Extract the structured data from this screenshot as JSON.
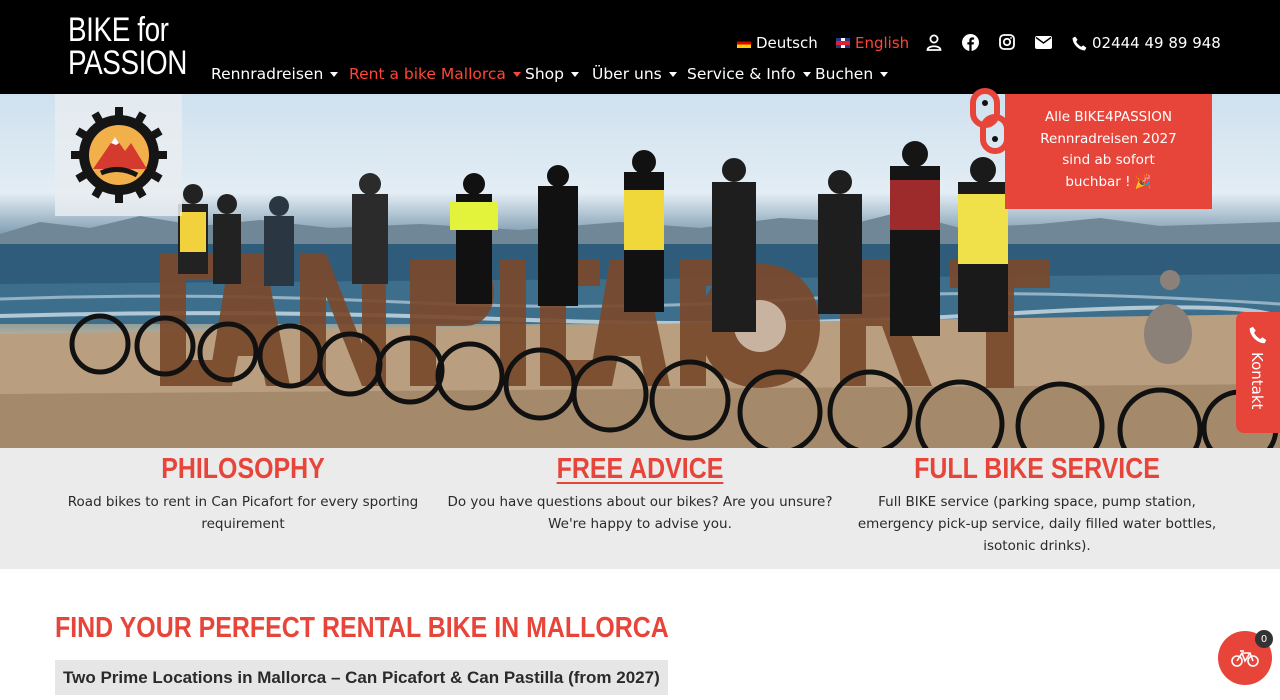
{
  "header": {
    "logo_line1": "BIKE for",
    "logo_line2": "PASSION",
    "lang_de": "Deutsch",
    "lang_en": "English",
    "phone": "02444 49 89 948",
    "icons": [
      "user-icon",
      "facebook-icon",
      "instagram-icon",
      "mail-icon",
      "phone-icon"
    ]
  },
  "nav": {
    "items": [
      {
        "label": "Rennradreisen"
      },
      {
        "label": "Rent a bike Mallorca"
      },
      {
        "label": "Shop"
      },
      {
        "label": "Über uns"
      },
      {
        "label": "Service & Info"
      },
      {
        "label": "Buchen"
      }
    ],
    "active_index": 1
  },
  "hero": {
    "promo_line1": "Alle BIKE4PASSION",
    "promo_line2": "Rennradreisen 2027",
    "promo_line3": "sind ab sofort",
    "promo_line4": "buchbar ! 🎉",
    "sign_text": "CAN PICAFORT",
    "kontakt_label": "Kontakt"
  },
  "features": [
    {
      "title": "PHILOSOPHY",
      "text_line1": "Road bikes to rent in Can Picafort for every sporting",
      "text_line2": "requirement"
    },
    {
      "title": "FREE ADVICE",
      "text_line1": "Do you have questions about our bikes? Are you unsure?",
      "text_line2": "We're happy to advise you."
    },
    {
      "title": "FULL BIKE SERVICE",
      "text_line1": "Full BIKE service (parking space, pump station,",
      "text_line2": "emergency pick-up service, daily filled water bottles,",
      "text_line3": "isotonic drinks)."
    }
  ],
  "main": {
    "section_title": "FIND YOUR PERFECT RENTAL BIKE IN MALLORCA",
    "locations_heading": "Two Prime Locations in Mallorca – Can Picafort & Can Pastilla (from 2027)"
  },
  "cart": {
    "count": "0"
  },
  "colors": {
    "accent": "#e8453a",
    "header_bg": "#000000",
    "feature_bg": "#ebebeb"
  }
}
